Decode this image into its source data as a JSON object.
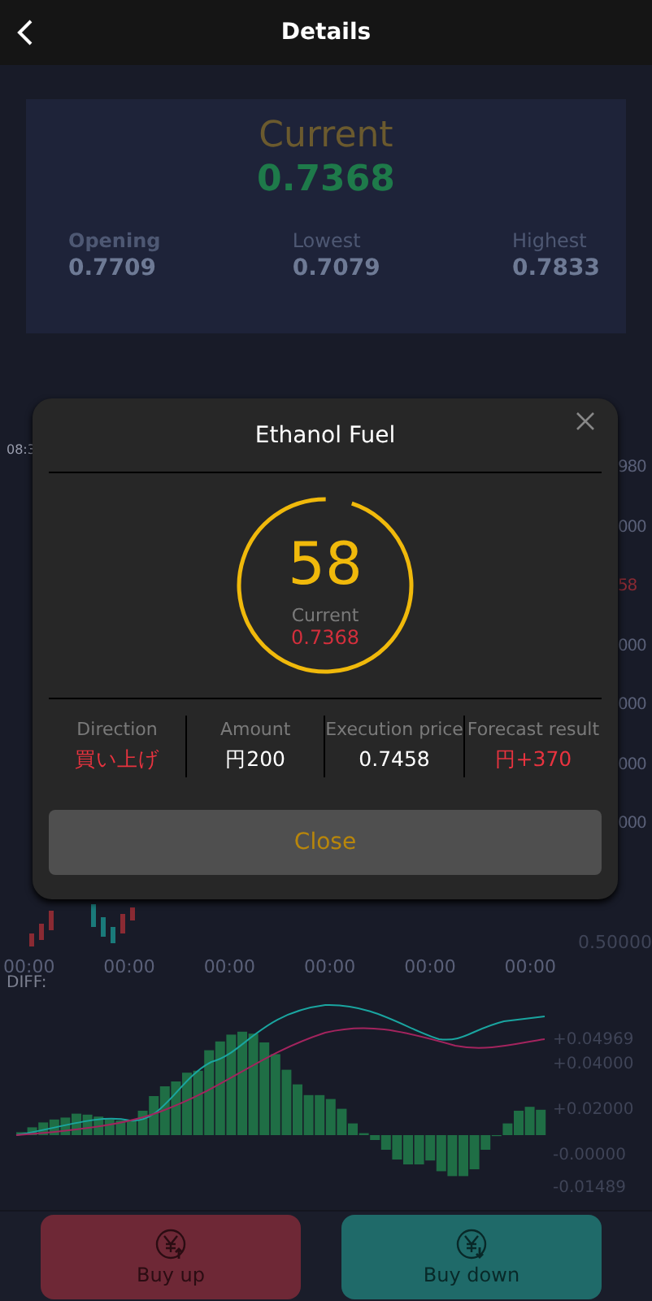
{
  "header": {
    "title": "Details"
  },
  "summary": {
    "label": "Current",
    "value": "0.7368",
    "stats": [
      {
        "label": "Opening",
        "value": "0.7709",
        "bold": true
      },
      {
        "label": "Lowest",
        "value": "0.7079",
        "bold": false
      },
      {
        "label": "Highest",
        "value": "0.7833",
        "bold": false
      }
    ]
  },
  "price_chart": {
    "time_label": "08:3",
    "axis_labels": [
      {
        "text": "980",
        "kind": "tick"
      },
      {
        "text": "000",
        "kind": "tick"
      },
      {
        "text": "58",
        "kind": "current"
      },
      {
        "text": "000",
        "kind": "tick"
      },
      {
        "text": "000",
        "kind": "tick"
      },
      {
        "text": "000",
        "kind": "tick"
      },
      {
        "text": "000",
        "kind": "tick"
      }
    ],
    "bottom_label": "0.50000",
    "times": [
      "00:00",
      "00:00",
      "00:00",
      "00:00",
      "00:00",
      "00:00"
    ]
  },
  "macd_chart": {
    "legend": "DIFF:",
    "axis_labels": [
      "+0.04969",
      "+0.04000",
      "+0.02000",
      "-0.00000",
      "-0.01489"
    ]
  },
  "dialog": {
    "title": "Ethanol Fuel",
    "countdown": "58",
    "level": 0.95,
    "current_label": "Current",
    "current_value": "0.7368",
    "columns": [
      {
        "label": "Direction",
        "value": "買い上げ",
        "color": "#e8333f"
      },
      {
        "label": "Amount",
        "value": "円200",
        "color": "#ffffff"
      },
      {
        "label": "Execution price",
        "value": "0.7458",
        "color": "#ffffff"
      },
      {
        "label": "Forecast result",
        "value": "円+370",
        "color": "#e8333f"
      }
    ],
    "button": "Close"
  },
  "actions": [
    {
      "label": "Buy up",
      "kind": "up"
    },
    {
      "label": "Buy down",
      "kind": "down"
    }
  ]
}
